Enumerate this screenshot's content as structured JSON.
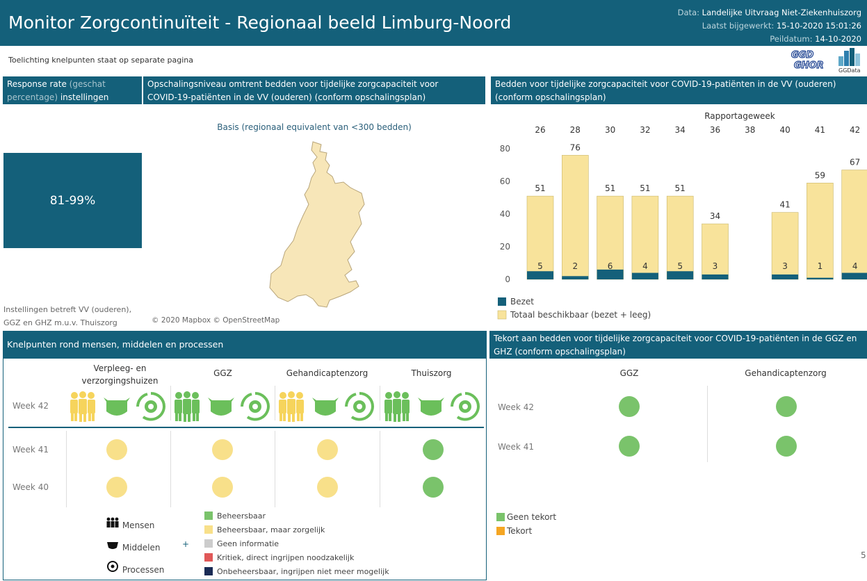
{
  "header": {
    "title": "Monitor Zorgcontinuïteit - Regionaal beeld Limburg-Noord",
    "data_label": "Data:",
    "data_value": "Landelijke Uitvraag Niet-Ziekenhuiszorg",
    "updated_label": "Laatst bijgewerkt:",
    "updated_value": "15-10-2020 15:01:26",
    "peil_label": "Peildatum:",
    "peil_value": "14-10-2020"
  },
  "subtitle": "Toelichting knelpunten staat op separate pagina",
  "logos": {
    "ggd_line1": "GGD",
    "ggd_line2": "GHOR",
    "ggdata": "GGData"
  },
  "response": {
    "title_a": "Response rate",
    "title_b": "(geschat",
    "title_c": "percentage)",
    "title_d": "instellingen",
    "value": "81-99%",
    "footnote_1": "Instellingen betreft VV (ouderen),",
    "footnote_2": "GGZ en GHZ m.u.v. Thuiszorg"
  },
  "opschaling": {
    "title_1": "Opschalingsniveau omtrent bedden voor tijdelijke zorgcapaciteit voor",
    "title_2": "COVID-19-patiënten in de VV (ouderen) (conform opschalingsplan)",
    "level": "Basis (regionaal equivalent van <300 bedden)",
    "credit": "© 2020 Mapbox © OpenStreetMap",
    "map_color": "#f7e6b8"
  },
  "beds": {
    "title_1": "Bedden voor tijdelijke zorgcapaciteit voor COVID-19-patiënten in de VV (ouderen)",
    "title_2": "(conform opschalingsplan)"
  },
  "chart_data": {
    "type": "bar",
    "top_axis_title": "Rapportageweek",
    "categories": [
      "26",
      "28",
      "30",
      "32",
      "34",
      "36",
      "38",
      "40",
      "41",
      "42"
    ],
    "ylim": [
      0,
      80
    ],
    "yticks": [
      "0",
      "20",
      "40",
      "60",
      "80"
    ],
    "series": [
      {
        "name": "Bezet",
        "color": "#14607a",
        "values": [
          5,
          2,
          6,
          4,
          5,
          3,
          null,
          3,
          1,
          4
        ],
        "labels": [
          "5",
          "2",
          "6",
          "4",
          "5",
          "3",
          "",
          "3",
          "1",
          "4"
        ]
      },
      {
        "name": "Totaal beschikbaar (bezet + leeg)",
        "color": "#f8e39b",
        "values": [
          51,
          76,
          51,
          51,
          51,
          34,
          null,
          41,
          59,
          67
        ],
        "labels": [
          "51",
          "76",
          "51",
          "51",
          "51",
          "34",
          "",
          "41",
          "59",
          "67"
        ]
      }
    ],
    "legend_position": "bottom-left",
    "grid": false
  },
  "knelpunten": {
    "title": "Knelpunten rond mensen, middelen en processen",
    "columns": [
      {
        "line1": "Verpleeg- en",
        "line2": "verzorgingshuizen"
      },
      {
        "line1": "GGZ",
        "line2": ""
      },
      {
        "line1": "Gehandicaptenzorg",
        "line2": ""
      },
      {
        "line1": "Thuiszorg",
        "line2": ""
      }
    ],
    "week42": "Week 42",
    "week42_icon_colors": [
      "#f6d45c",
      "#6bbf5b",
      "#6bbf5b",
      "#6bbf5b",
      "#6bbf5b",
      "#6bbf5b",
      "#f6d45c",
      "#6bbf5b",
      "#6bbf5b",
      "#6bbf5b",
      "#6bbf5b",
      "#6bbf5b"
    ],
    "rows": [
      {
        "week": "Week 41",
        "colors": [
          "#f8e08a",
          "#f8e08a",
          "#f8e08a",
          "#7ac36b"
        ]
      },
      {
        "week": "Week 40",
        "colors": [
          "#f8e08a",
          "#f8e08a",
          "#f8e08a",
          "#7ac36b"
        ]
      }
    ],
    "icon_legend": {
      "people": "Mensen",
      "resources": "Middelen",
      "processes": "Processen",
      "plus": "+"
    },
    "status_legend": [
      {
        "label": "Beheersbaar",
        "color": "#7ac36b"
      },
      {
        "label": "Beheersbaar, maar zorgelijk",
        "color": "#f8e08a"
      },
      {
        "label": "Geen informatie",
        "color": "#cccccc"
      },
      {
        "label": "Kritiek, direct ingrijpen noodzakelijk",
        "color": "#e05858"
      },
      {
        "label": "Onbeheersbaar, ingrijpen niet meer mogelijk",
        "color": "#1a2b55"
      }
    ]
  },
  "tekort": {
    "title_1": "Tekort aan bedden voor tijdelijke zorgcapaciteit voor COVID-19-patiënten in de GGZ en",
    "title_2": "GHZ (conform opschalingsplan)",
    "columns": [
      "GGZ",
      "Gehandicaptenzorg"
    ],
    "rows": [
      {
        "week": "Week 42",
        "colors": [
          "#7ac36b",
          "#7ac36b"
        ]
      },
      {
        "week": "Week 41",
        "colors": [
          "#7ac36b",
          "#7ac36b"
        ]
      }
    ],
    "legend": [
      {
        "label": "Geen tekort",
        "color": "#7ac36b"
      },
      {
        "label": "Tekort",
        "color": "#f5a623"
      }
    ]
  },
  "page_number": "5"
}
